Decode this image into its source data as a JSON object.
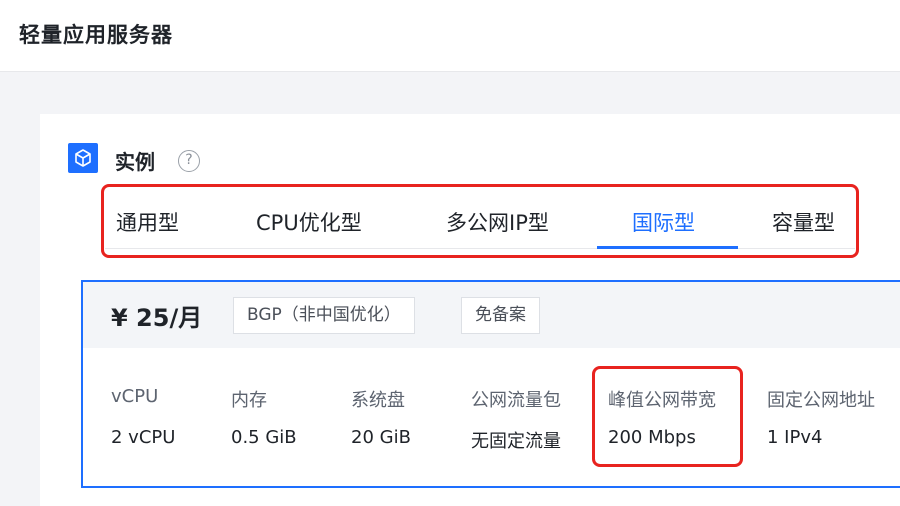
{
  "header": {
    "title": "轻量应用服务器"
  },
  "section": {
    "icon": "cube-icon",
    "title": "实例",
    "help_icon": "question-circle-icon",
    "help_glyph": "?"
  },
  "tabs": [
    {
      "label": "通用型",
      "active": false
    },
    {
      "label": "CPU优化型",
      "active": false
    },
    {
      "label": "多公网IP型",
      "active": false
    },
    {
      "label": "国际型",
      "active": true
    },
    {
      "label": "容量型",
      "active": false
    }
  ],
  "plan": {
    "price": "¥ 25/月",
    "tags": [
      "BGP（非中国优化）",
      "免备案"
    ],
    "specs": [
      {
        "label": "vCPU",
        "value": "2 vCPU"
      },
      {
        "label": "内存",
        "value": "0.5 GiB"
      },
      {
        "label": "系统盘",
        "value": "20 GiB"
      },
      {
        "label": "公网流量包",
        "value": "无固定流量"
      },
      {
        "label": "峰值公网带宽",
        "value": "200 Mbps",
        "highlighted": true
      },
      {
        "label": "固定公网地址",
        "value": "1 IPv4"
      }
    ]
  },
  "colors": {
    "accent": "#1e6fff",
    "highlight": "#e8231f",
    "text": "#1f2329",
    "muted": "#5d6470"
  }
}
